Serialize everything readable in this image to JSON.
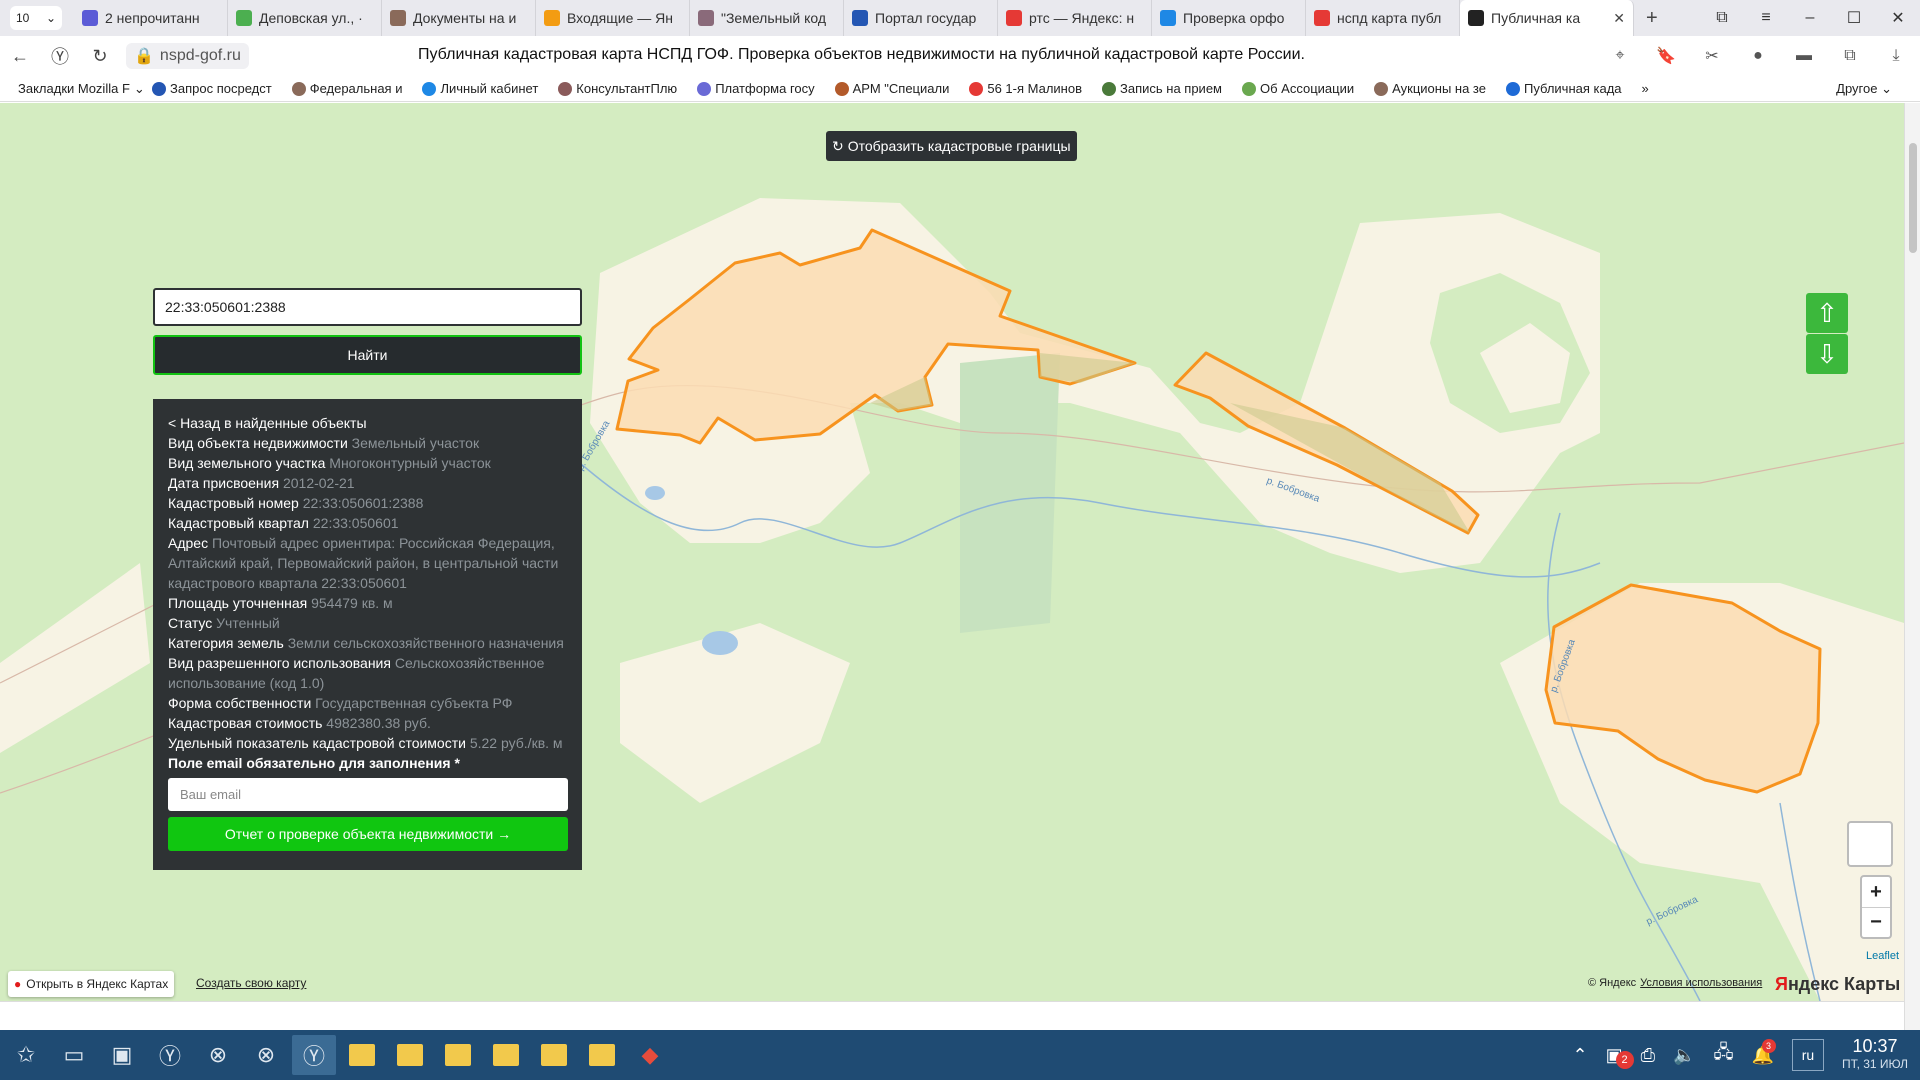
{
  "browser": {
    "tab_count": "10",
    "tabs": [
      {
        "title": "2 непрочитанн",
        "color": "#5b5bd6"
      },
      {
        "title": "Деповская ул., ·",
        "color": "#4caf50"
      },
      {
        "title": "Документы на и",
        "color": "#8a6a5a"
      },
      {
        "title": "Входящие — Ян",
        "color": "#f39c12"
      },
      {
        "title": "\"Земельный код",
        "color": "#8a6a7a"
      },
      {
        "title": "Портал государ",
        "color": "#2456b3"
      },
      {
        "title": "ртс — Яндекс: н",
        "color": "#e53935"
      },
      {
        "title": "Проверка орфо",
        "color": "#1e88e5"
      },
      {
        "title": "нспд карта публ",
        "color": "#e53935"
      },
      {
        "title": "Публичная ка",
        "color": "#222222"
      }
    ],
    "url": "nspd-gof.ru",
    "page_title": "Публичная кадастровая карта НСПД ГОФ. Проверка объектов недвижимости на публичной кадастровой карте России.",
    "bookmarks": [
      {
        "label": "Закладки Mozilla F",
        "color": "#ffffff"
      },
      {
        "label": "Запрос посредст",
        "color": "#2456b3"
      },
      {
        "label": "Федеральная и",
        "color": "#8a6a5a"
      },
      {
        "label": "Личный кабинет",
        "color": "#1e88e5"
      },
      {
        "label": "КонсультантПлю",
        "color": "#8a5a5a"
      },
      {
        "label": "Платформа госу",
        "color": "#6a6ad6"
      },
      {
        "label": "АРМ \"Специали",
        "color": "#b35a2a"
      },
      {
        "label": "56 1-я Малинов",
        "color": "#e53935"
      },
      {
        "label": "Запись на прием",
        "color": "#4a7a3a"
      },
      {
        "label": "Об Ассоциации",
        "color": "#6aa84f"
      },
      {
        "label": "Аукционы на зе",
        "color": "#8a6a5a"
      },
      {
        "label": "Публичная када",
        "color": "#1e6ad6"
      }
    ],
    "bookmarks_other": "Другое"
  },
  "map": {
    "cadastral_button": "Отобразить кадастровые границы",
    "search_value": "22:33:050601:2388",
    "find_button": "Найти",
    "panel": {
      "back_link": "< Назад в найденные объекты",
      "rows": [
        {
          "label": "Вид объекта недвижимости",
          "value": "Земельный участок"
        },
        {
          "label": "Вид земельного участка",
          "value": "Многоконтурный участок"
        },
        {
          "label": "Дата присвоения",
          "value": "2012-02-21"
        },
        {
          "label": "Кадастровый номер",
          "value": "22:33:050601:2388"
        },
        {
          "label": "Кадастровый квартал",
          "value": "22:33:050601"
        },
        {
          "label": "Адрес",
          "value": "Почтовый адрес ориентира: Российская Федерация, Алтайский край, Первомайский район, в центральной части кадастрового квартала 22:33:050601"
        },
        {
          "label": "Площадь уточненная",
          "value": "954479 кв. м"
        },
        {
          "label": "Статус",
          "value": "Учтенный"
        },
        {
          "label": "Категория земель",
          "value": "Земли сельскохозяйственного назначения"
        },
        {
          "label": "Вид разрешенного использования",
          "value": "Сельскохозяйственное использование (код 1.0)"
        },
        {
          "label": "Форма собственности",
          "value": "Государственная субъекта РФ"
        },
        {
          "label": "Кадастровая стоимость",
          "value": "4982380.38 руб."
        },
        {
          "label": "Удельный показатель кадастровой стоимости",
          "value": "5.22 руб./кв. м"
        }
      ],
      "email_required": "Поле email обязательно для заполнения *",
      "email_placeholder": "Ваш email",
      "report_button": "Отчет о проверке объекта недвижимости →"
    },
    "river_labels": [
      "р. Бобровка",
      "р. Бобровка",
      "р. Бобровка",
      "р. Бобровка"
    ],
    "zoom_in": "+",
    "zoom_out": "−",
    "leaflet": "Leaflet",
    "open_yandex": "Открыть в Яндекс Картах",
    "create_map": "Создать свою карту",
    "copyright": "© Яндекс",
    "terms": "Условия использования",
    "logo_red": "Я",
    "logo_rest": "ндекс Карты"
  },
  "taskbar": {
    "badge_count": "2",
    "notif_count": "3",
    "lang": "ru",
    "time": "10:37",
    "date": "ПТ, 31 ИЮЛ"
  }
}
